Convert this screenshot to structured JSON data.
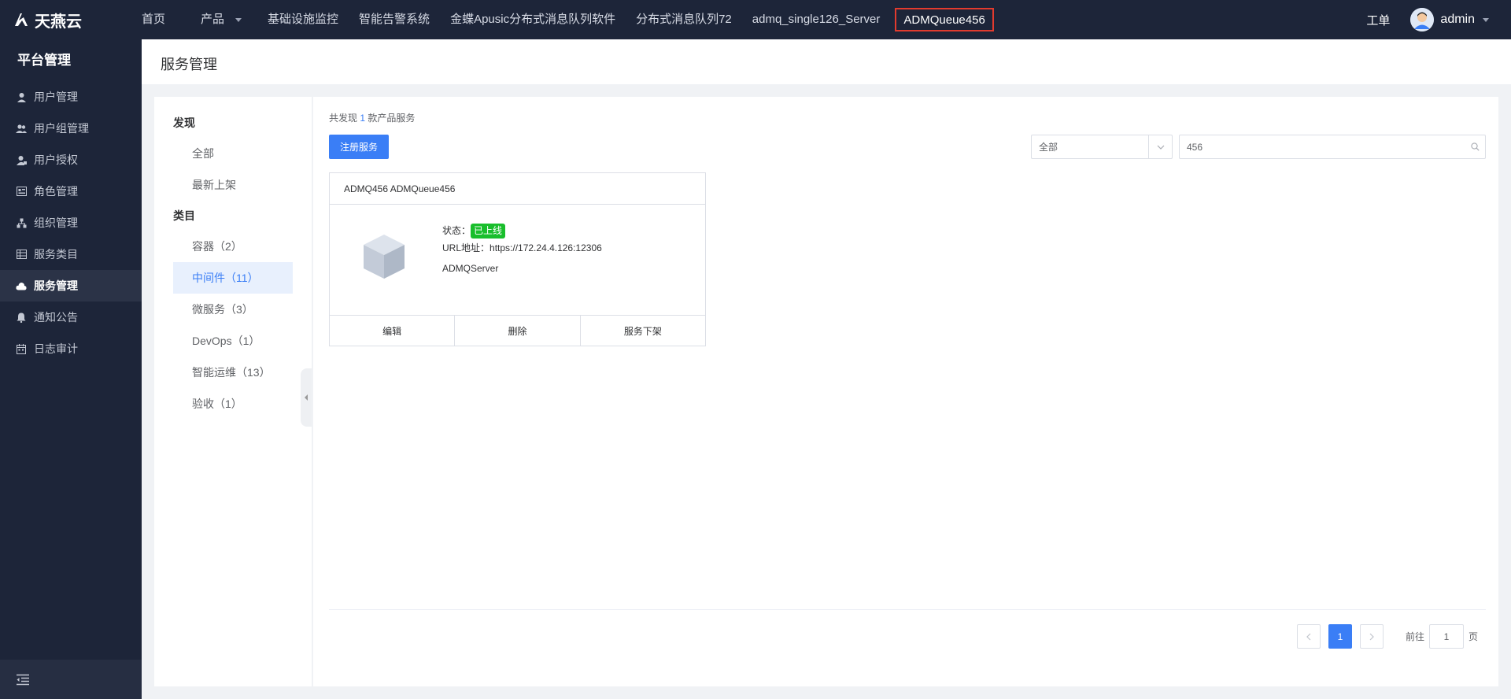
{
  "brand": {
    "name": "天燕云"
  },
  "topnav": {
    "items": [
      "首页",
      "产品",
      "基础设施监控",
      "智能告警系统",
      "金蝶Apusic分布式消息队列软件",
      "分布式消息队列72",
      "admq_single126_Server",
      "ADMQueue456"
    ],
    "work_order": "工单",
    "user": "admin"
  },
  "sidebar": {
    "title": "平台管理",
    "items": [
      {
        "label": "用户管理",
        "icon": "user-icon"
      },
      {
        "label": "用户组管理",
        "icon": "user-group-icon"
      },
      {
        "label": "用户授权",
        "icon": "user-auth-icon"
      },
      {
        "label": "角色管理",
        "icon": "role-icon"
      },
      {
        "label": "组织管理",
        "icon": "org-icon"
      },
      {
        "label": "服务类目",
        "icon": "category-icon"
      },
      {
        "label": "服务管理",
        "icon": "cloud-icon",
        "active": true
      },
      {
        "label": "通知公告",
        "icon": "bell-icon"
      },
      {
        "label": "日志审计",
        "icon": "calendar-icon"
      }
    ]
  },
  "page": {
    "title": "服务管理"
  },
  "filters": {
    "discover_title": "发现",
    "discover_items": [
      "全部",
      "最新上架"
    ],
    "category_title": "类目",
    "category_items": [
      "容器（2）",
      "中间件（11）",
      "微服务（3）",
      "DevOps（1）",
      "智能运维（13）",
      "验收（1）"
    ]
  },
  "content": {
    "found_prefix": "共发现",
    "found_count": "1",
    "found_suffix": "款产品服务",
    "register_button": "注册服务",
    "select_value": "全部",
    "search_value": "456"
  },
  "card": {
    "title": "ADMQ456 ADMQueue456",
    "status_label": "状态：",
    "status_value": "已上线",
    "url_label": "URL地址：",
    "url_value": "https://172.24.4.126:12306",
    "server": "ADMQServer",
    "actions": [
      "编辑",
      "删除",
      "服务下架"
    ]
  },
  "pagination": {
    "current": "1",
    "goto_label": "前往",
    "goto_value": "1",
    "unit": "页"
  },
  "colors": {
    "primary": "#3a7ef6",
    "nav_bg": "#1d2539",
    "status_green": "#19be2c",
    "highlight_border": "#e23b2e"
  }
}
